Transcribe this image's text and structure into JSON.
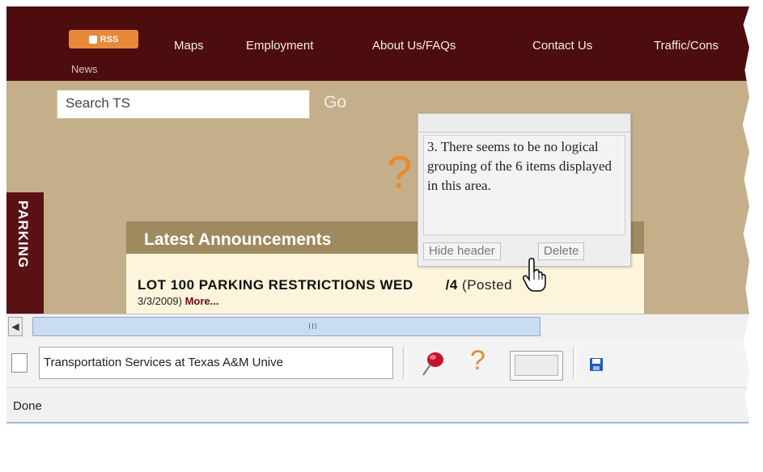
{
  "nav": {
    "rss_label": "RSS",
    "rss_news": "News",
    "links": [
      "Maps",
      "Employment",
      "About Us/FAQs",
      "Contact Us",
      "Traffic/Cons"
    ]
  },
  "search": {
    "value": "Search TS",
    "go_label": "Go"
  },
  "sidebar": {
    "parking_label": "PARKING"
  },
  "announcements": {
    "title": "Latest Announcements",
    "headline": "LOT 100 PARKING RESTRICTIONS WED",
    "headline_tail": "/4",
    "posted_prefix": "(Posted",
    "posted_date": "3/3/2009)",
    "more_label": "More..."
  },
  "note": {
    "text": "3. There seems to be no logical grouping of the 6 items displayed in this area.",
    "hide_header_label": "Hide header",
    "delete_label": "Delete"
  },
  "toolbar": {
    "page_title_value": "Transportation Services at Texas A&M Unive",
    "scroll_grip": "III"
  },
  "status": {
    "text": "Done"
  },
  "colors": {
    "nav_bg": "#4d0d0f",
    "page_bg": "#c5ae8a",
    "accent_orange": "#e88a2c",
    "announcement_header": "#9f895f",
    "parking_bg": "#5a1114"
  },
  "icons": [
    "rss-icon",
    "question-mark-icon",
    "hand-cursor-icon",
    "scroll-left-icon",
    "document-icon",
    "push-pin-icon",
    "thumbnail-icon",
    "save-icon"
  ]
}
